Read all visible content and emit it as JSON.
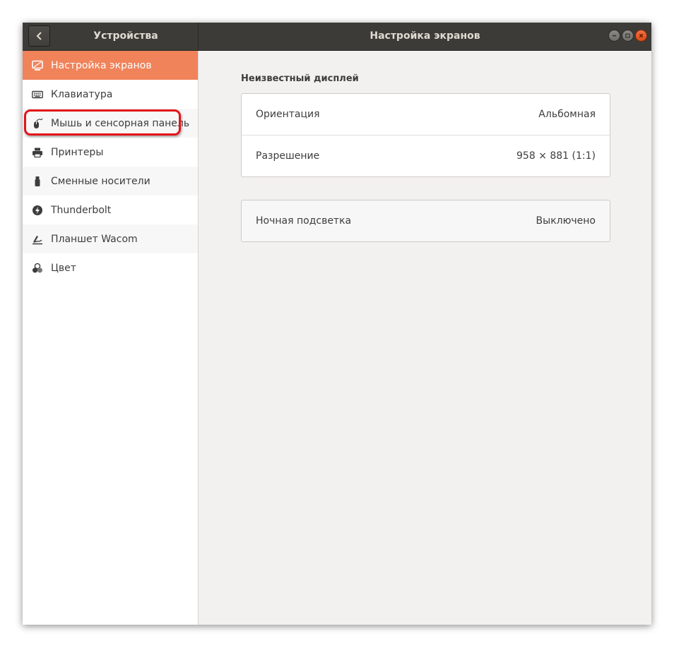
{
  "header": {
    "sidebar_title": "Устройства",
    "main_title": "Настройка экранов"
  },
  "sidebar": {
    "items": [
      {
        "label": "Настройка экранов",
        "icon": "display-icon",
        "active": true
      },
      {
        "label": "Клавиатура",
        "icon": "keyboard-icon",
        "highlighted": true
      },
      {
        "label": "Мышь и сенсорная панель",
        "icon": "mouse-icon"
      },
      {
        "label": "Принтеры",
        "icon": "printer-icon"
      },
      {
        "label": "Сменные носители",
        "icon": "usb-drive-icon"
      },
      {
        "label": "Thunderbolt",
        "icon": "thunderbolt-icon"
      },
      {
        "label": "Планшет Wacom",
        "icon": "tablet-pen-icon"
      },
      {
        "label": "Цвет",
        "icon": "color-icon"
      }
    ]
  },
  "main": {
    "section_title": "Неизвестный дисплей",
    "display_settings": [
      {
        "label": "Ориентация",
        "value": "Альбомная"
      },
      {
        "label": "Разрешение",
        "value": "958 × 881 (1:1)"
      }
    ],
    "night_light": {
      "label": "Ночная подсветка",
      "value": "Выключено"
    }
  },
  "colors": {
    "accent": "#f0835a",
    "headerbar": "#3c3b37",
    "close_button": "#e9541f",
    "highlight_outline": "#e3141a"
  }
}
